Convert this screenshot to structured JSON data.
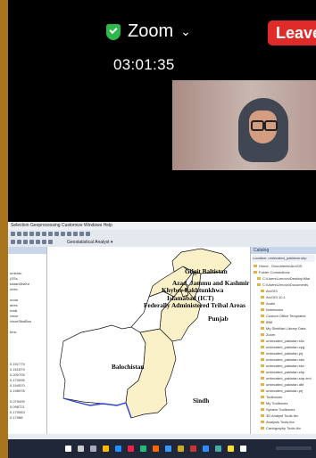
{
  "zoom": {
    "title": "Zoom",
    "timer": "03:01:35",
    "leave_label": "Leave",
    "colors": {
      "leave": "#e02b2b",
      "secure": "#2fb84a"
    }
  },
  "arcmap": {
    "menu": "Selection  Geoprocessing  Customize  Windows  Help",
    "toolbar_label": "Geostatistical Analyst ▾",
    "toc_header": "",
    "toc_items": [
      "umbrac",
      "(SSs",
      "kistanDistKe",
      "ories",
      "",
      "unda",
      "aries",
      "ncial",
      "vince",
      "vinceStistBou",
      "",
      "bmc",
      "",
      "",
      "",
      "",
      "",
      "",
      "",
      "",
      "0.151779",
      "0.151579",
      "0.200705",
      "0.170096",
      "0.194570",
      "0.198978",
      "",
      "0.079499",
      "0.098721",
      "0.170063",
      "0.17988"
    ],
    "labels": {
      "gilgit": "Gilgit Baltistan",
      "azad": "Azad, Jammu and Kashmir",
      "khyber": "Khyber Pakhtunkhwa",
      "islamabad": "Islamabad (ICT)",
      "fata": "Federally Administered Tribal Areas",
      "punjab": "Punjab",
      "balochistan": "Balochistan",
      "sindh": "Sindh"
    },
    "catalog": {
      "header": "Catalog",
      "location": "Location:  umlecated_pakistan.shp",
      "items": [
        "Home - Documents\\ArcGIS",
        "Folder Connections",
        "C:\\Users\\Lenovo\\Desktop\\Mai",
        "C:\\Users\\Lenovo\\Documents",
        "ArcGIS",
        "ArcGIS 10.1",
        "Audio",
        "Notebooks",
        "Custom Office Templates",
        "IBM",
        "My SheMart Library Data",
        "Zoom",
        "umlecated_pakistan.shx",
        "umlecated_pakistan.cpg",
        "umlecated_pakistan.prj",
        "umlecated_pakistan.sbn",
        "umlecated_pakistan.sbx",
        "umlecated_pakistan.shp",
        "umlecated_pakistan.shp.xml",
        "umlecated_pakistan.dbf",
        "umlecated_pakistan.prj",
        "Toolboxes",
        "My Toolboxes",
        "System Toolboxes",
        "3D Analyst Tools.tbx",
        "Analysis Tools.tbx",
        "Cartography Tools.tbx"
      ]
    }
  }
}
